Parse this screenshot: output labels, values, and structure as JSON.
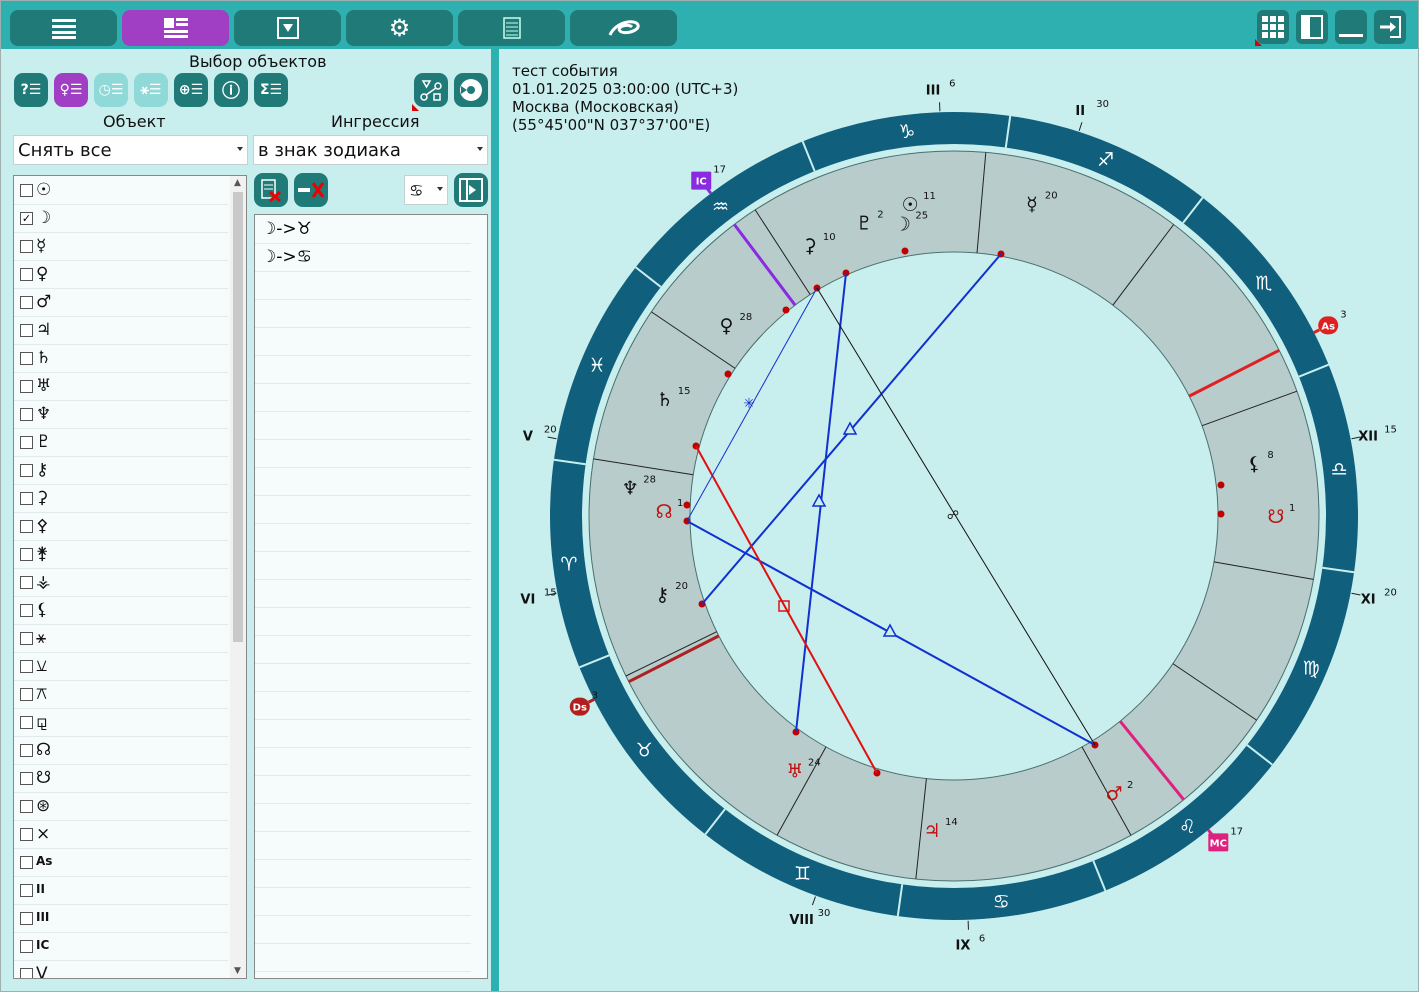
{
  "toolbar": {
    "icons": [
      "menu-icon",
      "layout-icon",
      "dropdown-icon",
      "gear-icon",
      "table-icon",
      "logo-icon"
    ],
    "right_icons": [
      "grid-icon",
      "panel-icon",
      "minimize-icon",
      "exit-icon"
    ]
  },
  "panel": {
    "title": "Выбор объектов",
    "object_label": "Объект",
    "ingression_label": "Ингрессия",
    "object_select": "Снять все",
    "ingression_select": "в знак зодиака",
    "sign_select": "♋",
    "tool_icons": [
      "help-list-icon",
      "object-list-icon",
      "time-list-icon",
      "aspect-list-icon",
      "globe-list-icon",
      "info-icon",
      "sum-icon"
    ],
    "objects": [
      {
        "s": "☉",
        "c": false
      },
      {
        "s": "☽",
        "c": true
      },
      {
        "s": "☿",
        "c": false
      },
      {
        "s": "♀",
        "c": false
      },
      {
        "s": "♂",
        "c": false
      },
      {
        "s": "♃",
        "c": false
      },
      {
        "s": "♄",
        "c": false
      },
      {
        "s": "♅",
        "c": false
      },
      {
        "s": "♆",
        "c": false
      },
      {
        "s": "♇",
        "c": false
      },
      {
        "s": "⚷",
        "c": false
      },
      {
        "s": "⚳",
        "c": false
      },
      {
        "s": "⚴",
        "c": false
      },
      {
        "s": "⚵",
        "c": false
      },
      {
        "s": "⚶",
        "c": false
      },
      {
        "s": "⚸",
        "c": false
      },
      {
        "s": "⚹",
        "c": false
      },
      {
        "s": "⚺",
        "c": false
      },
      {
        "s": "⚻",
        "c": false
      },
      {
        "s": "⚼",
        "c": false
      },
      {
        "s": "☊",
        "c": false
      },
      {
        "s": "☋",
        "c": false
      },
      {
        "s": "⊛",
        "c": false
      },
      {
        "s": "⨯",
        "c": false
      },
      {
        "s": "As",
        "c": false
      },
      {
        "s": "II",
        "c": false
      },
      {
        "s": "III",
        "c": false
      },
      {
        "s": "IC",
        "c": false
      },
      {
        "s": "V",
        "c": false
      }
    ],
    "ingressions": [
      "☽->♉",
      "☽->♋"
    ]
  },
  "event": {
    "title": "тест события",
    "datetime": "01.01.2025 03:00:00 (UTC+3)",
    "place": "Москва (Московская)",
    "coords": "(55°45'00\"N 037°37'00\"E)"
  },
  "chart_data": {
    "type": "astrological-wheel",
    "signs": [
      "♑",
      "♐",
      "♏",
      "♎",
      "♍",
      "♌",
      "♋",
      "♊",
      "♉",
      "♈",
      "♓",
      "♒"
    ],
    "houses": [
      {
        "label": "III",
        "deg": "6"
      },
      {
        "label": "II",
        "deg": "30"
      },
      {
        "label": "XII",
        "deg": "15"
      },
      {
        "label": "XI",
        "deg": "20"
      },
      {
        "label": "IX",
        "deg": "6"
      },
      {
        "label": "VIII",
        "deg": "30"
      },
      {
        "label": "VI",
        "deg": "15"
      },
      {
        "label": "V",
        "deg": "20"
      }
    ],
    "angles": [
      {
        "label": "IC",
        "deg": "17",
        "color": "#8a2be2"
      },
      {
        "label": "As",
        "deg": "3",
        "color": "#e02020"
      },
      {
        "label": "MC",
        "deg": "17",
        "color": "#e0207f"
      },
      {
        "label": "Ds",
        "deg": "3",
        "color": "#b02020"
      }
    ],
    "planets": [
      {
        "s": "☉",
        "deg": "11",
        "color": "#111"
      },
      {
        "s": "☿",
        "deg": "20",
        "color": "#111"
      },
      {
        "s": "⚳",
        "deg": "10",
        "color": "#111"
      },
      {
        "s": "♇",
        "deg": "2",
        "color": "#111"
      },
      {
        "s": "☽",
        "deg": "25",
        "color": "#111"
      },
      {
        "s": "♀",
        "deg": "28",
        "color": "#111"
      },
      {
        "s": "♄",
        "deg": "15",
        "color": "#111"
      },
      {
        "s": "♆",
        "deg": "28",
        "color": "#111"
      },
      {
        "s": "☊",
        "deg": "1",
        "color": "#c01010"
      },
      {
        "s": "⚷",
        "deg": "20",
        "color": "#111"
      },
      {
        "s": "♅",
        "deg": "24",
        "color": "#c01010"
      },
      {
        "s": "♃",
        "deg": "14",
        "color": "#c01010"
      },
      {
        "s": "♂",
        "deg": "2",
        "color": "#c01010"
      },
      {
        "s": "⚸",
        "deg": "8",
        "color": "#111"
      },
      {
        "s": "☋",
        "deg": "1",
        "color": "#c01010"
      }
    ]
  }
}
